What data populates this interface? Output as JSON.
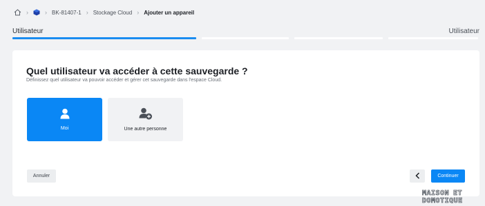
{
  "breadcrumb": {
    "items": [
      "BK-81407-1",
      "Stockage Cloud",
      "Ajouter un appareil"
    ]
  },
  "steps": {
    "current_label": "Utilisateur",
    "next_label": "Utilisateur",
    "count": 4,
    "active_index": 0
  },
  "main": {
    "title": "Quel utilisateur va accéder à cette sauvegarde ?",
    "subtitle": "Définissez quel utilisateur va pouvoir accéder et gérer cet sauvegarde dans l'espace Cloud.",
    "options": [
      {
        "label": "Moi",
        "icon": "user-icon",
        "selected": true
      },
      {
        "label": "Une autre personne",
        "icon": "add-user-icon",
        "selected": false
      }
    ]
  },
  "footer": {
    "cancel_label": "Annuler",
    "back_icon": "chevron-left-icon",
    "continue_label": "Continuer"
  },
  "watermark": {
    "line1": "MAISON ET",
    "line2": "DOMOTIQUE"
  },
  "colors": {
    "accent": "#0a87f5",
    "background": "#f1f2f4",
    "card": "#ffffff"
  }
}
